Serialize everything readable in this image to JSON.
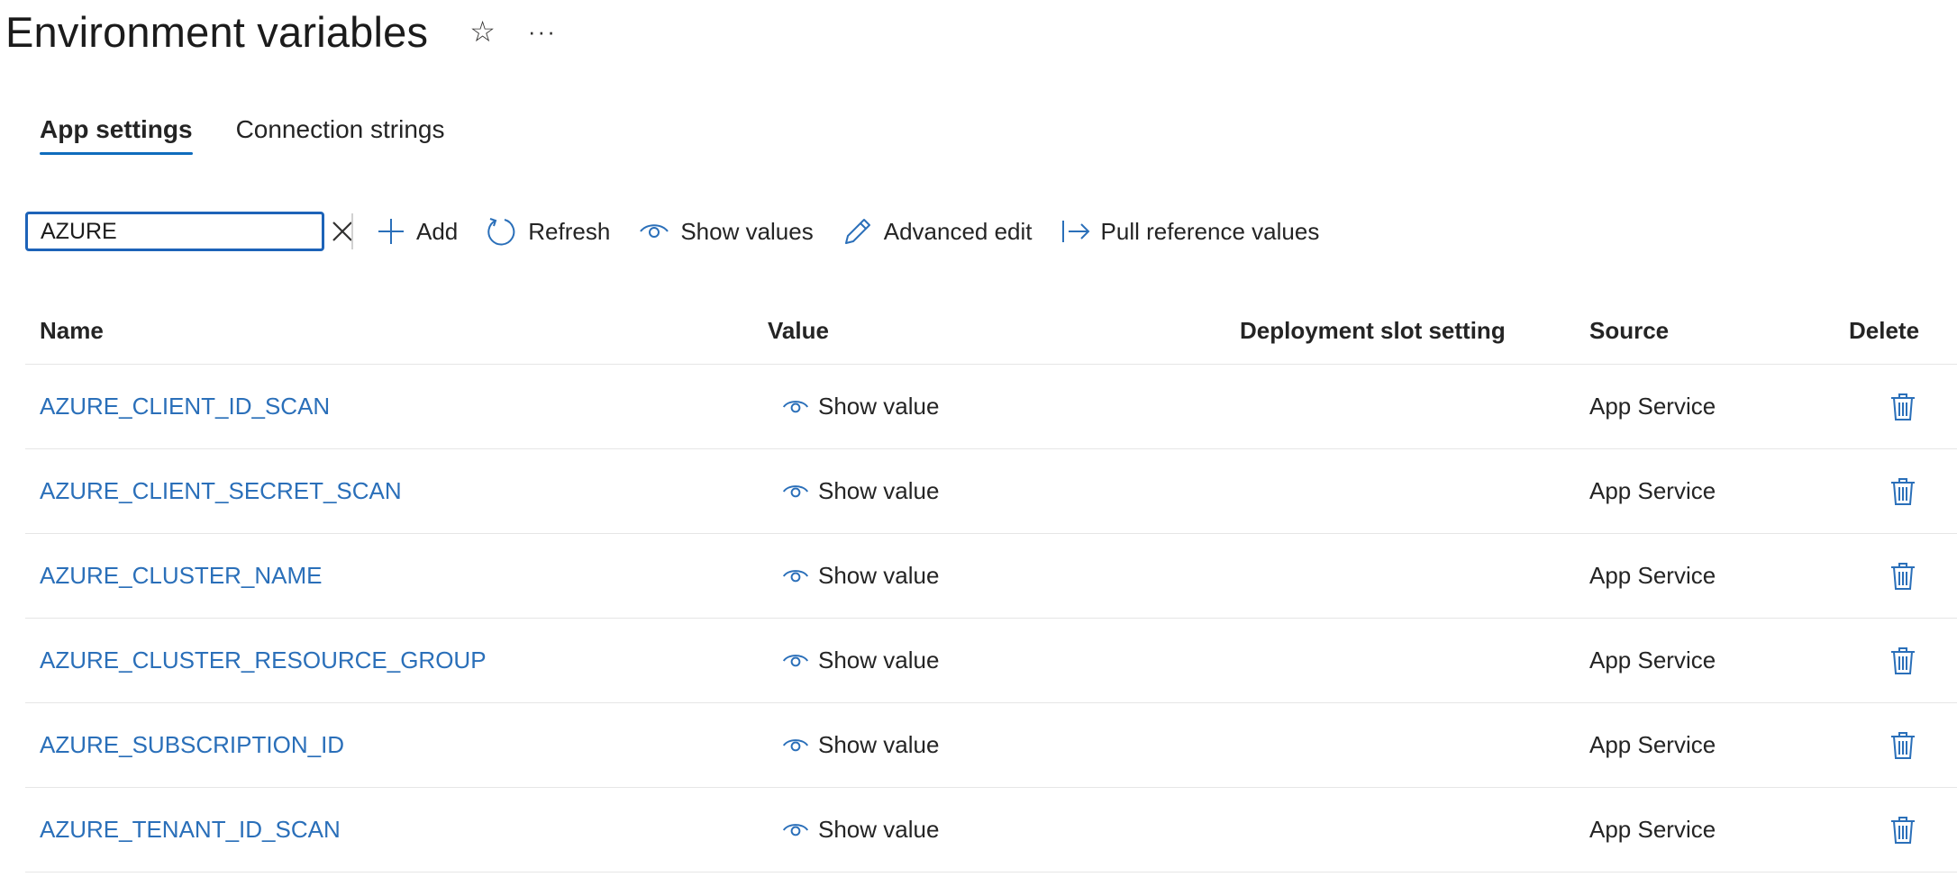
{
  "header": {
    "title": "Environment variables",
    "favorite_icon": "star-icon",
    "more_icon": "ellipsis-icon",
    "more_glyph": "···"
  },
  "tabs": [
    {
      "label": "App settings",
      "active": true
    },
    {
      "label": "Connection strings",
      "active": false
    }
  ],
  "toolbar": {
    "search_value": "AZURE",
    "add_label": "Add",
    "refresh_label": "Refresh",
    "show_values_label": "Show values",
    "advanced_edit_label": "Advanced edit",
    "pull_reference_label": "Pull reference values"
  },
  "table": {
    "columns": [
      "Name",
      "Value",
      "Deployment slot setting",
      "Source",
      "Delete"
    ],
    "rows": [
      {
        "name": "AZURE_CLIENT_ID_SCAN",
        "value": "Show value",
        "slot": "",
        "source": "App Service"
      },
      {
        "name": "AZURE_CLIENT_SECRET_SCAN",
        "value": "Show value",
        "slot": "",
        "source": "App Service"
      },
      {
        "name": "AZURE_CLUSTER_NAME",
        "value": "Show value",
        "slot": "",
        "source": "App Service"
      },
      {
        "name": "AZURE_CLUSTER_RESOURCE_GROUP",
        "value": "Show value",
        "slot": "",
        "source": "App Service"
      },
      {
        "name": "AZURE_SUBSCRIPTION_ID",
        "value": "Show value",
        "slot": "",
        "source": "App Service"
      },
      {
        "name": "AZURE_TENANT_ID_SCAN",
        "value": "Show value",
        "slot": "",
        "source": "App Service"
      }
    ]
  },
  "colors": {
    "accent": "#0f6cbd",
    "link": "#2a6fb9",
    "icon_blue": "#2a6fb9"
  }
}
